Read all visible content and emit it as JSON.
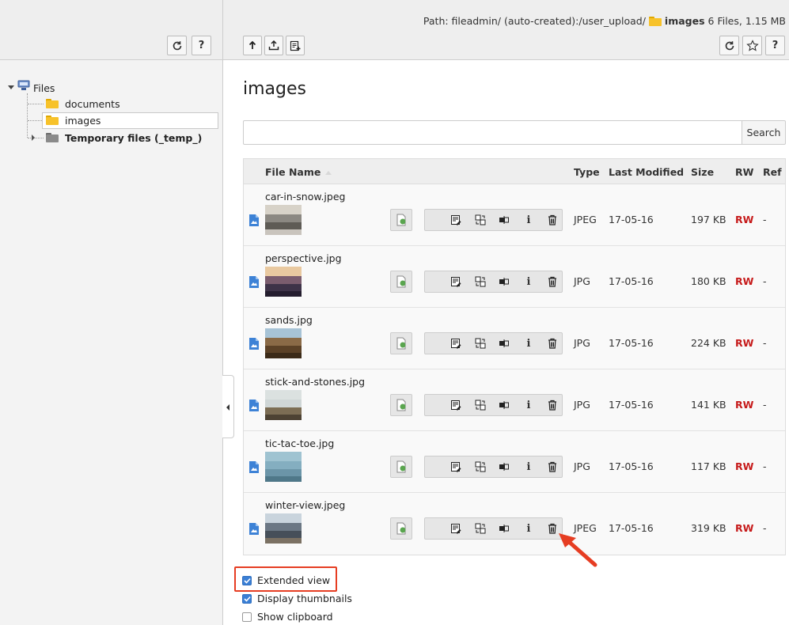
{
  "left": {
    "buttons": {
      "refresh_icon": "refresh-icon",
      "help_label": "?"
    },
    "tree": {
      "root": "Files",
      "items": [
        {
          "label": "documents",
          "color": "#f7c22a"
        },
        {
          "label": "images",
          "color": "#f7c22a",
          "selected": true
        },
        {
          "label": "Temporary files (_temp_)",
          "color": "#8a8a8a",
          "bold": true
        }
      ]
    }
  },
  "header": {
    "path_prefix": "Path: fileadmin/ (auto-created):/user_upload/",
    "folder_name": "images",
    "folder_summary": "6 Files, 1.15 MB",
    "toolbar_icons": [
      "upload-icon",
      "upload-alt-icon",
      "new-file-icon"
    ],
    "right_help_label": "?"
  },
  "main": {
    "title": "images",
    "search": {
      "placeholder": "",
      "value": "",
      "button_label": "Search"
    },
    "table": {
      "columns": {
        "name": "File Name",
        "type": "Type",
        "modified": "Last Modified",
        "size": "Size",
        "rw": "RW",
        "ref": "Ref"
      },
      "rows": [
        {
          "name": "car-in-snow.jpeg",
          "type": "JPEG",
          "modified": "17-05-16",
          "size": "197 KB",
          "rw": "RW",
          "ref": "-"
        },
        {
          "name": "perspective.jpg",
          "type": "JPG",
          "modified": "17-05-16",
          "size": "180 KB",
          "rw": "RW",
          "ref": "-"
        },
        {
          "name": "sands.jpg",
          "type": "JPG",
          "modified": "17-05-16",
          "size": "224 KB",
          "rw": "RW",
          "ref": "-"
        },
        {
          "name": "stick-and-stones.jpg",
          "type": "JPG",
          "modified": "17-05-16",
          "size": "141 KB",
          "rw": "RW",
          "ref": "-"
        },
        {
          "name": "tic-tac-toe.jpg",
          "type": "JPG",
          "modified": "17-05-16",
          "size": "117 KB",
          "rw": "RW",
          "ref": "-"
        },
        {
          "name": "winter-view.jpeg",
          "type": "JPEG",
          "modified": "17-05-16",
          "size": "319 KB",
          "rw": "RW",
          "ref": "-"
        }
      ],
      "info_label": "i"
    },
    "options": [
      {
        "label": "Extended view",
        "checked": true
      },
      {
        "label": "Display thumbnails",
        "checked": true
      },
      {
        "label": "Show clipboard",
        "checked": false
      }
    ]
  },
  "colors": {
    "accent": "#3a7fd5",
    "rw": "#c61a1a",
    "highlight": "#e63d22",
    "folder": "#f7c22a"
  }
}
